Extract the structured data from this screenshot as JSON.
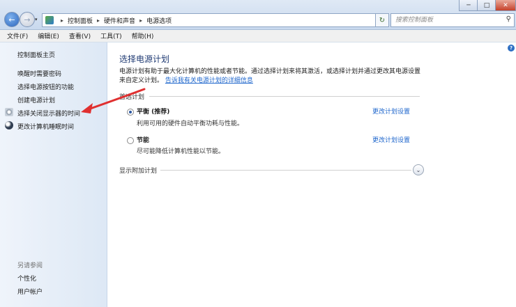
{
  "window": {
    "min": "─",
    "max": "□",
    "close": "✕"
  },
  "address": {
    "breadcrumbs": [
      "控制面板",
      "硬件和声音",
      "电源选项"
    ],
    "separator": "▸",
    "dropdown": "▾",
    "refresh": "↻",
    "search_placeholder": "搜索控制面板",
    "search_icon": "search-icon"
  },
  "nav": {
    "back": "←",
    "forward": "→",
    "recent": "▾"
  },
  "menu": [
    "文件(F)",
    "编辑(E)",
    "查看(V)",
    "工具(T)",
    "帮助(H)"
  ],
  "sidebar": {
    "home": "控制面板主页",
    "links": [
      "唤醒时需要密码",
      "选择电源按钮的功能",
      "创建电源计划",
      "选择关闭显示器的时间",
      "更改计算机睡眠时间"
    ],
    "icons": [
      "monitor-icon",
      "moon-icon"
    ],
    "see_also_title": "另请参阅",
    "see_also": [
      "个性化",
      "用户帐户"
    ]
  },
  "main": {
    "help": "?",
    "title": "选择电源计划",
    "desc_line1": "电源计划有助于最大化计算机的性能或者节能。通过选择计划来将其激活，或选择计划并通过更改其电源设置",
    "desc_line2_prefix": "来自定义计划。",
    "desc_link": "告诉我有关电源计划的详细信息",
    "group": "首选计划",
    "plans": [
      {
        "name": "平衡 (推荐)",
        "desc": "利用可用的硬件自动平衡功耗与性能。",
        "link": "更改计划设置",
        "selected": true
      },
      {
        "name": "节能",
        "desc": "尽可能降低计算机性能以节能。",
        "link": "更改计划设置",
        "selected": false
      }
    ],
    "more": "显示附加计划",
    "expand": "⌄"
  },
  "colors": {
    "link": "#1e66cc",
    "title": "#1f3a73",
    "annotation_arrow": "#e03030"
  }
}
